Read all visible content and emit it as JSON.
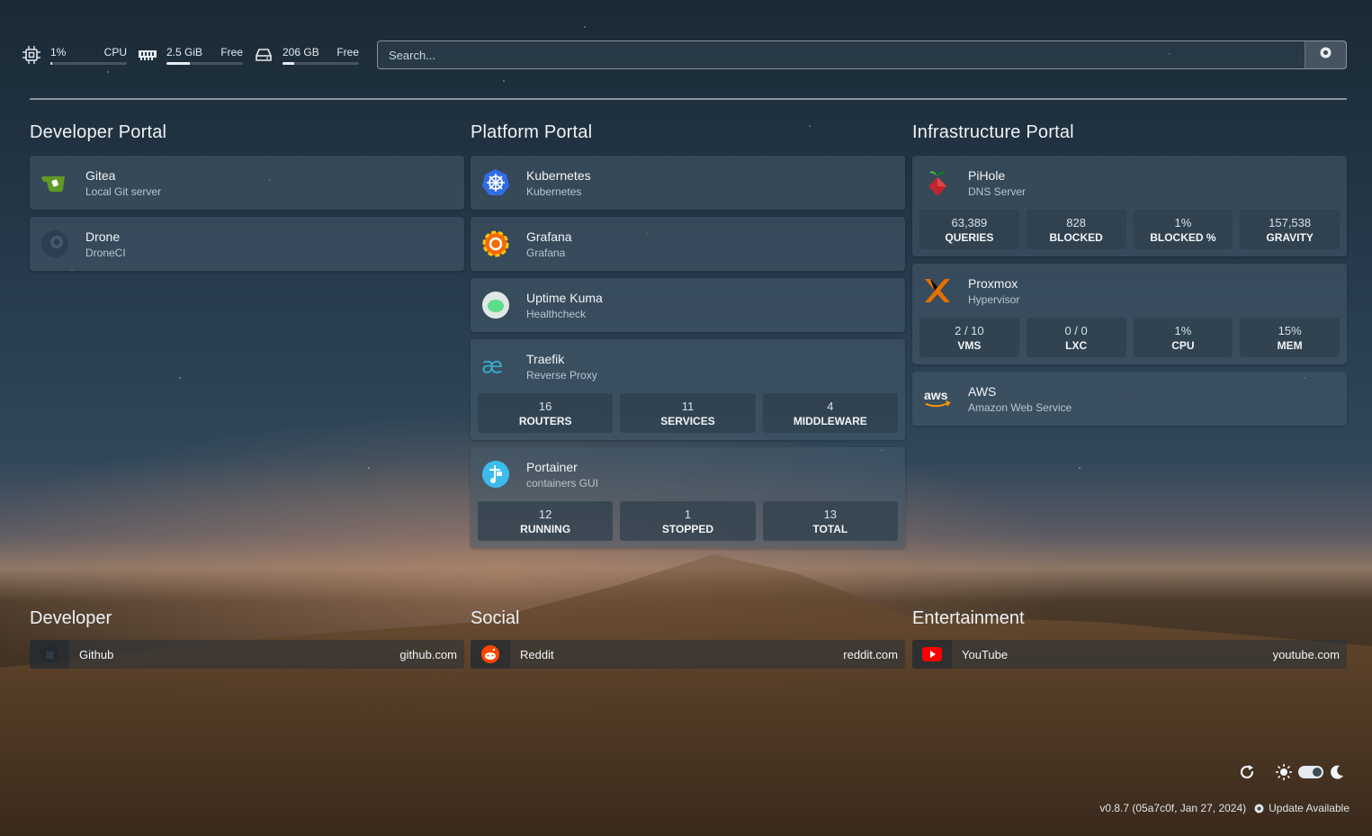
{
  "resources": {
    "cpu": {
      "value": "1%",
      "label": "CPU",
      "fill": 0.01
    },
    "memory": {
      "value": "2.5 GiB",
      "label": "Free",
      "fill": 0.3
    },
    "disk": {
      "value": "206 GB",
      "label": "Free",
      "fill": 0.15
    }
  },
  "search": {
    "placeholder": "Search..."
  },
  "services": [
    {
      "title": "Developer Portal",
      "items": [
        {
          "name": "Gitea",
          "desc": "Local Git server",
          "icon": "gitea-icon"
        },
        {
          "name": "Drone",
          "desc": "DroneCI",
          "icon": "drone-icon"
        }
      ]
    },
    {
      "title": "Platform Portal",
      "items": [
        {
          "name": "Kubernetes",
          "desc": "Kubernetes",
          "icon": "kubernetes-icon"
        },
        {
          "name": "Grafana",
          "desc": "Grafana",
          "icon": "grafana-icon"
        },
        {
          "name": "Uptime Kuma",
          "desc": "Healthcheck",
          "icon": "uptime-kuma-icon"
        },
        {
          "name": "Traefik",
          "desc": "Reverse Proxy",
          "icon": "traefik-icon",
          "stats": [
            {
              "value": "16",
              "label": "ROUTERS"
            },
            {
              "value": "11",
              "label": "SERVICES"
            },
            {
              "value": "4",
              "label": "MIDDLEWARE"
            }
          ]
        },
        {
          "name": "Portainer",
          "desc": "containers GUI",
          "icon": "portainer-icon",
          "stats": [
            {
              "value": "12",
              "label": "RUNNING"
            },
            {
              "value": "1",
              "label": "STOPPED"
            },
            {
              "value": "13",
              "label": "TOTAL"
            }
          ]
        }
      ]
    },
    {
      "title": "Infrastructure Portal",
      "items": [
        {
          "name": "PiHole",
          "desc": "DNS Server",
          "icon": "pihole-icon",
          "stats": [
            {
              "value": "63,389",
              "label": "QUERIES"
            },
            {
              "value": "828",
              "label": "BLOCKED"
            },
            {
              "value": "1%",
              "label": "BLOCKED %"
            },
            {
              "value": "157,538",
              "label": "GRAVITY"
            }
          ]
        },
        {
          "name": "Proxmox",
          "desc": "Hypervisor",
          "icon": "proxmox-icon",
          "stats": [
            {
              "value": "2 / 10",
              "label": "VMS"
            },
            {
              "value": "0 / 0",
              "label": "LXC"
            },
            {
              "value": "1%",
              "label": "CPU"
            },
            {
              "value": "15%",
              "label": "MEM"
            }
          ]
        },
        {
          "name": "AWS",
          "desc": "Amazon Web Service",
          "icon": "aws-icon"
        }
      ]
    }
  ],
  "bookmarks": [
    {
      "title": "Developer",
      "items": [
        {
          "name": "Github",
          "url": "github.com",
          "icon": "github-icon"
        }
      ]
    },
    {
      "title": "Social",
      "items": [
        {
          "name": "Reddit",
          "url": "reddit.com",
          "icon": "reddit-icon"
        }
      ]
    },
    {
      "title": "Entertainment",
      "items": [
        {
          "name": "YouTube",
          "url": "youtube.com",
          "icon": "youtube-icon"
        }
      ]
    }
  ],
  "footer": {
    "version": "v0.8.7 (05a7c0f, Jan 27, 2024)",
    "update": "Update Available"
  },
  "colors": {
    "accent": "#e6ebf0",
    "card_bg": "#465a69",
    "gitea": "#609926",
    "kubernetes": "#326ce5",
    "grafana": "#f46800",
    "reddit": "#ff4500",
    "youtube": "#ff0000",
    "proxmox": "#e57000"
  }
}
